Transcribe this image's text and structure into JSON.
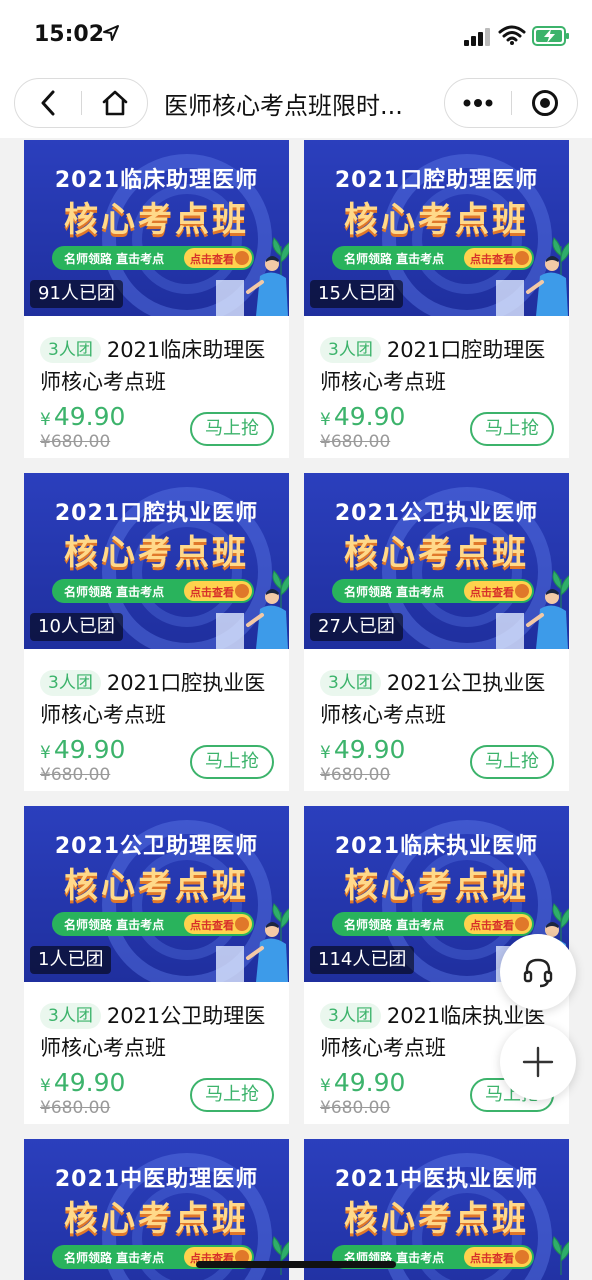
{
  "status": {
    "time": "15:02"
  },
  "nav": {
    "title": "医师核心考点班限时..."
  },
  "products": [
    {
      "banner_title": "2021临床助理医师",
      "banner_sub": "核心考点班",
      "strip_text": "名师领路 直击考点",
      "strip_btn": "点击查看",
      "joined": "91人已团",
      "team": "3人团",
      "name": "2021临床助理医师核心考点班",
      "price": "49.90",
      "old_price": "¥680.00",
      "buy": "马上抢"
    },
    {
      "banner_title": "2021口腔助理医师",
      "banner_sub": "核心考点班",
      "strip_text": "名师领路 直击考点",
      "strip_btn": "点击查看",
      "joined": "15人已团",
      "team": "3人团",
      "name": "2021口腔助理医师核心考点班",
      "price": "49.90",
      "old_price": "¥680.00",
      "buy": "马上抢"
    },
    {
      "banner_title": "2021口腔执业医师",
      "banner_sub": "核心考点班",
      "strip_text": "名师领路 直击考点",
      "strip_btn": "点击查看",
      "joined": "10人已团",
      "team": "3人团",
      "name": "2021口腔执业医师核心考点班",
      "price": "49.90",
      "old_price": "¥680.00",
      "buy": "马上抢"
    },
    {
      "banner_title": "2021公卫执业医师",
      "banner_sub": "核心考点班",
      "strip_text": "名师领路 直击考点",
      "strip_btn": "点击查看",
      "joined": "27人已团",
      "team": "3人团",
      "name": "2021公卫执业医师核心考点班",
      "price": "49.90",
      "old_price": "¥680.00",
      "buy": "马上抢"
    },
    {
      "banner_title": "2021公卫助理医师",
      "banner_sub": "核心考点班",
      "strip_text": "名师领路 直击考点",
      "strip_btn": "点击查看",
      "joined": "1人已团",
      "team": "3人团",
      "name": "2021公卫助理医师核心考点班",
      "price": "49.90",
      "old_price": "¥680.00",
      "buy": "马上抢"
    },
    {
      "banner_title": "2021临床执业医师",
      "banner_sub": "核心考点班",
      "strip_text": "名师领路 直击考点",
      "strip_btn": "点击查看",
      "joined": "114人已团",
      "team": "3人团",
      "name": "2021临床执业医师核心考点班",
      "price": "49.90",
      "old_price": "¥680.00",
      "buy": "马上抢"
    },
    {
      "banner_title": "2021中医助理医师",
      "banner_sub": "核心考点班",
      "strip_text": "名师领路 直击考点",
      "strip_btn": "点击查看",
      "joined": "",
      "team": "",
      "name": "",
      "price": "",
      "old_price": "",
      "buy": ""
    },
    {
      "banner_title": "2021中医执业医师",
      "banner_sub": "核心考点班",
      "strip_text": "名师领路 直击考点",
      "strip_btn": "点击查看",
      "joined": "",
      "team": "",
      "name": "",
      "price": "",
      "old_price": "",
      "buy": ""
    }
  ],
  "icons": {
    "location": "location-arrow-icon",
    "signal": "signal-icon",
    "wifi": "wifi-icon",
    "battery": "battery-charging-icon",
    "back": "chevron-left-icon",
    "home": "home-icon",
    "more": "more-dots-icon",
    "close": "target-close-icon",
    "service": "headset-icon",
    "add": "plus-icon"
  },
  "colors": {
    "accent_green": "#3cb36b",
    "banner_blue": "#2b3fbd",
    "banner_gold": "#ffd98a"
  }
}
